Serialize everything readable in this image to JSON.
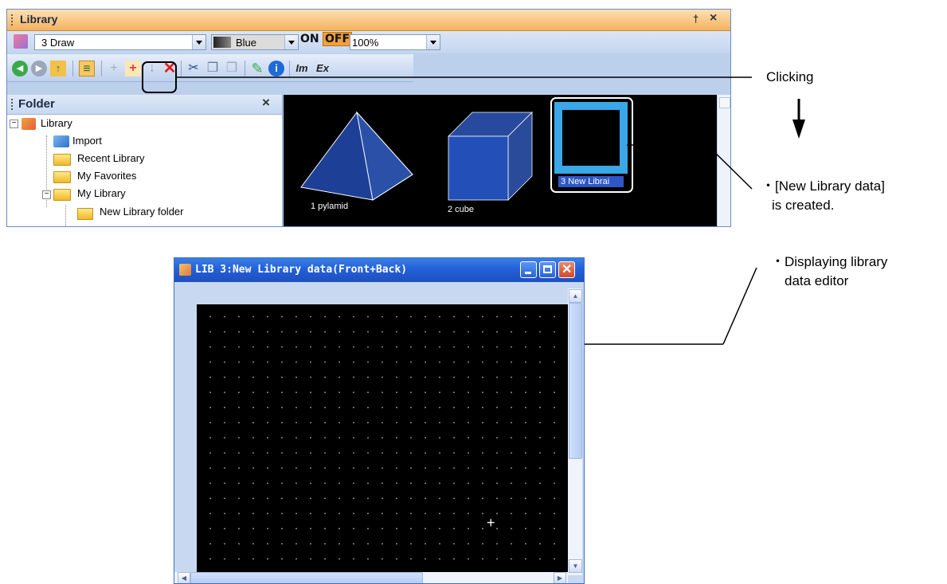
{
  "library_window": {
    "title": "Library",
    "pin_glyph": "†",
    "close_glyph": "×",
    "draw_combo": {
      "value": "3 Draw"
    },
    "color_combo": {
      "value": "Blue"
    },
    "on_label": "ON",
    "off_label": "OFF",
    "zoom_combo": {
      "value": "100%"
    },
    "toolbar": {
      "back_glyph": "◀",
      "forward_glyph": "▶",
      "up_glyph": "↑",
      "tree_glyph": "≡",
      "new_folder_glyph": "+",
      "new_data_glyph": "+",
      "down_glyph": "↓",
      "delete_glyph": "✕",
      "cut_glyph": "✂",
      "copy_glyph": "❐",
      "paste_glyph": "❒",
      "edit_glyph": "✎",
      "info_glyph": "i",
      "import_label": "Im",
      "export_label": "Ex"
    }
  },
  "folder_pane": {
    "title": "Folder",
    "close_glyph": "×",
    "tree": {
      "root": "Library",
      "items": [
        "Import",
        "Recent Library",
        "My Favorites",
        "My Library"
      ],
      "sub_item": "New Library folder",
      "collapse_glyph": "−"
    }
  },
  "thumbnails": [
    {
      "label": "1 pylamid"
    },
    {
      "label": "2 cube"
    },
    {
      "label": "3 New Librai"
    }
  ],
  "annotations": {
    "clicking": "Clicking",
    "created_line1": "・[New Library data]",
    "created_line2": "is created.",
    "editor_line1": "・Displaying library",
    "editor_line2": "data editor"
  },
  "editor_window": {
    "title": "LIB 3:New Library data(Front+Back)",
    "cursor_glyph": "+",
    "scroll_up_glyph": "▲",
    "scroll_down_glyph": "▼",
    "scroll_left_glyph": "◀",
    "scroll_right_glyph": "▶"
  },
  "colors": {
    "library_title_bar": "#f4b25d",
    "editor_title_bar": "#2461d8",
    "accent_blue": "#3a9ad9",
    "off_button": "#f0a040"
  }
}
